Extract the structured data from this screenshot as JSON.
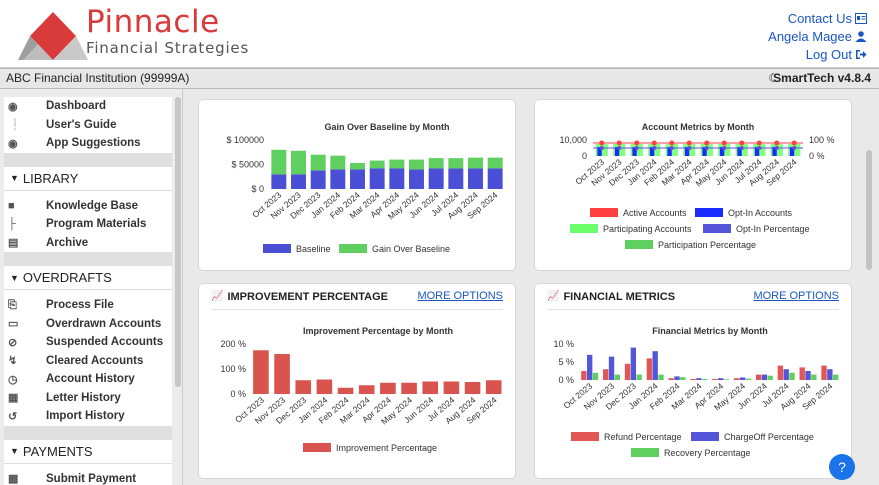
{
  "header": {
    "brand_name": "Pinnacle",
    "brand_sub": "Financial Strategies",
    "contact": "Contact Us",
    "user": "Angela Magee",
    "logout": "Log Out"
  },
  "institution": {
    "name": "ABC Financial Institution (99999A)",
    "theme_icon": "moon-icon",
    "version": "SmartTech v4.8.4"
  },
  "sidebar": {
    "top_items": [
      {
        "label": "Dashboard",
        "icon": "dashboard-icon"
      },
      {
        "label": "User's Guide",
        "icon": "info-icon"
      },
      {
        "label": "App Suggestions",
        "icon": "comment-icon"
      }
    ],
    "library_title": "LIBRARY",
    "library_items": [
      {
        "label": "Knowledge Base",
        "icon": "folder-icon"
      },
      {
        "label": "Program Materials",
        "icon": "sitemap-icon"
      },
      {
        "label": "Archive",
        "icon": "archive-icon"
      }
    ],
    "overdrafts_title": "OVERDRAFTS",
    "overdraft_items": [
      {
        "label": "Process File",
        "icon": "file-import-icon"
      },
      {
        "label": "Overdrawn Accounts",
        "icon": "credit-card-icon"
      },
      {
        "label": "Suspended Accounts",
        "icon": "ban-icon"
      },
      {
        "label": "Cleared Accounts",
        "icon": "bolt-icon"
      },
      {
        "label": "Account History",
        "icon": "clock-icon"
      },
      {
        "label": "Letter History",
        "icon": "calendar-icon"
      },
      {
        "label": "Import History",
        "icon": "history-icon"
      }
    ],
    "payments_title": "PAYMENTS",
    "payment_items": [
      {
        "label": "Submit Payment",
        "icon": "money-icon"
      }
    ]
  },
  "panels": {
    "improvement_title": "IMPROVEMENT PERCENTAGE",
    "financial_title": "FINANCIAL METRICS",
    "more_options": "MORE OPTIONS"
  },
  "colors": {
    "brand_red": "#d93a3a",
    "link_blue": "#1a56c4",
    "baseline": "#4a4fd6",
    "gain": "#5fcf5f",
    "improvement": "#d9534f",
    "refund": "#e15757",
    "chargeoff": "#5555d9",
    "recovery": "#5fd05f"
  },
  "chart_data": [
    {
      "type": "bar",
      "title": "Gain Over Baseline by Month",
      "stacked": true,
      "categories": [
        "Oct 2023",
        "Nov 2023",
        "Dec 2023",
        "Jan 2024",
        "Feb 2024",
        "Mar 2024",
        "Apr 2024",
        "May 2024",
        "Jun 2024",
        "Jul 2024",
        "Aug 2024",
        "Sep 2024"
      ],
      "series": [
        {
          "name": "Baseline",
          "values": [
            30000,
            30000,
            38000,
            40000,
            40000,
            42000,
            42000,
            40000,
            42000,
            42000,
            42000,
            42000
          ]
        },
        {
          "name": "Gain Over Baseline",
          "values": [
            50000,
            48000,
            32000,
            28000,
            13000,
            16000,
            18000,
            20000,
            21000,
            21000,
            22000,
            22000
          ]
        }
      ],
      "yticks": [
        "$ 0",
        "$ 50000",
        "$ 100000"
      ],
      "ylim": [
        0,
        100000
      ]
    },
    {
      "type": "bar",
      "title": "Account Metrics by Month",
      "categories": [
        "Oct 2023",
        "Nov 2023",
        "Dec 2023",
        "Jan 2024",
        "Feb 2024",
        "Mar 2024",
        "Apr 2024",
        "May 2024",
        "Jun 2024",
        "Jul 2024",
        "Aug 2024",
        "Sep 2024"
      ],
      "series": [
        {
          "name": "Active Accounts"
        },
        {
          "name": "Opt-In Accounts"
        },
        {
          "name": "Participating Accounts"
        },
        {
          "name": "Opt-In Percentage"
        },
        {
          "name": "Participation Percentage"
        }
      ],
      "yticks_left": [
        "0",
        "10,000"
      ],
      "yticks_right": [
        "0 %",
        "100 %"
      ]
    },
    {
      "type": "bar",
      "title": "Improvement Percentage by Month",
      "categories": [
        "Oct 2023",
        "Nov 2023",
        "Dec 2023",
        "Jan 2024",
        "Feb 2024",
        "Mar 2024",
        "Apr 2024",
        "May 2024",
        "Jun 2024",
        "Jul 2024",
        "Aug 2024",
        "Sep 2024"
      ],
      "series": [
        {
          "name": "Improvement Percentage",
          "values": [
            175,
            160,
            55,
            58,
            25,
            35,
            45,
            45,
            50,
            50,
            48,
            55
          ]
        }
      ],
      "yticks": [
        "0 %",
        "100 %",
        "200 %"
      ],
      "ylim": [
        0,
        200
      ]
    },
    {
      "type": "bar",
      "title": "Financial Metrics by Month",
      "categories": [
        "Oct 2023",
        "Nov 2023",
        "Dec 2023",
        "Jan 2024",
        "Feb 2024",
        "Mar 2024",
        "Apr 2024",
        "May 2024",
        "Jun 2024",
        "Jul 2024",
        "Aug 2024",
        "Sep 2024"
      ],
      "series": [
        {
          "name": "Refund Percentage",
          "values": [
            2.5,
            3,
            4.5,
            6,
            0.5,
            0.3,
            0.3,
            0.5,
            1.5,
            4,
            3.5,
            4
          ]
        },
        {
          "name": "ChargeOff Percentage",
          "values": [
            7,
            6.5,
            9,
            8,
            1,
            0.5,
            0.5,
            0.7,
            1.5,
            3,
            2.5,
            3
          ]
        },
        {
          "name": "Recovery Percentage",
          "values": [
            2,
            1.5,
            1.5,
            1.5,
            0.8,
            0.3,
            0.2,
            0.4,
            1.2,
            2,
            1.5,
            1.5
          ]
        }
      ],
      "yticks": [
        "0 %",
        "5 %",
        "10 %"
      ],
      "ylim": [
        0,
        10
      ]
    }
  ]
}
